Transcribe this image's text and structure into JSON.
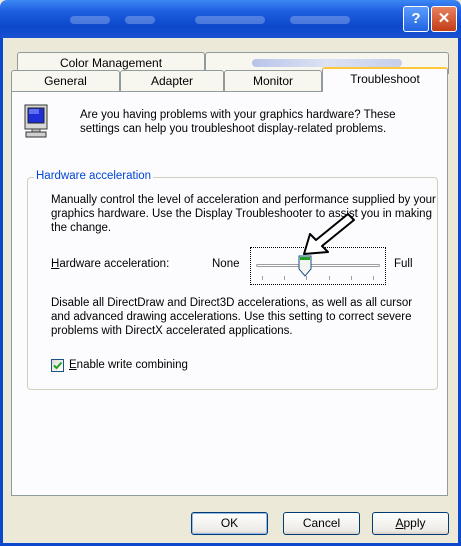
{
  "window": {
    "help_button": "?",
    "close_button": "✕"
  },
  "tabs_back_row": [
    {
      "label": "Color Management"
    },
    {
      "label": ""
    }
  ],
  "tabs_front_row": [
    {
      "label": "General"
    },
    {
      "label": "Adapter"
    },
    {
      "label": "Monitor"
    },
    {
      "label": "Troubleshoot",
      "active": true
    }
  ],
  "intro": {
    "text": "Are you having problems with your graphics hardware? These settings can help you troubleshoot display-related problems."
  },
  "hardware_acceleration": {
    "group_label": "Hardware acceleration",
    "description": "Manually control the level of acceleration and performance supplied by your graphics hardware. Use the Display Troubleshooter to assist you in making the change.",
    "slider_label_first": "H",
    "slider_label_rest": "ardware acceleration:",
    "min_label": "None",
    "max_label": "Full",
    "slider_value": 0.4,
    "slider_steps": 5,
    "disable_text": "Disable all DirectDraw and Direct3D accelerations, as well as all cursor and advanced drawing accelerations. Use this setting to correct severe problems with DirectX accelerated applications.",
    "checkbox_checked": true,
    "checkbox_label_first": "E",
    "checkbox_label_rest": "nable write combining"
  },
  "buttons": {
    "ok": "OK",
    "cancel": "Cancel",
    "apply_first": "A",
    "apply_rest": "pply"
  },
  "colors": {
    "titlebar": "#0b48cc",
    "group_label": "#0046d5",
    "active_tab_highlight": "#ffc83c",
    "checkmark": "#21a121"
  }
}
